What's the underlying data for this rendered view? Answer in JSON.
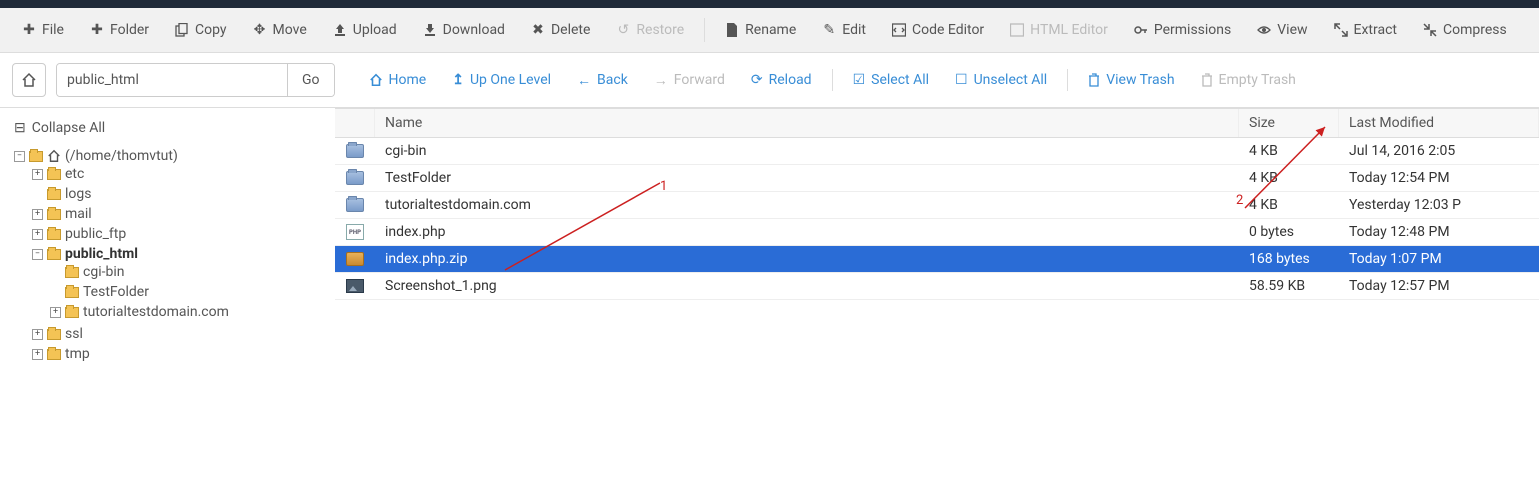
{
  "toolbar": {
    "file": "File",
    "folder": "Folder",
    "copy": "Copy",
    "move": "Move",
    "upload": "Upload",
    "download": "Download",
    "delete": "Delete",
    "restore": "Restore",
    "rename": "Rename",
    "edit": "Edit",
    "code_editor": "Code Editor",
    "html_editor": "HTML Editor",
    "permissions": "Permissions",
    "view": "View",
    "extract": "Extract",
    "compress": "Compress"
  },
  "path": {
    "value": "public_html",
    "go": "Go"
  },
  "nav": {
    "home": "Home",
    "up": "Up One Level",
    "back": "Back",
    "forward": "Forward",
    "reload": "Reload",
    "select_all": "Select All",
    "unselect_all": "Unselect All",
    "view_trash": "View Trash",
    "empty_trash": "Empty Trash"
  },
  "sidebar": {
    "collapse": "Collapse All",
    "root": "(/home/thomvtut)",
    "nodes": {
      "etc": "etc",
      "logs": "logs",
      "mail": "mail",
      "public_ftp": "public_ftp",
      "public_html": "public_html",
      "cgi_bin": "cgi-bin",
      "testfolder": "TestFolder",
      "tutorial": "tutorialtestdomain.com",
      "ssl": "ssl",
      "tmp": "tmp"
    }
  },
  "headers": {
    "name": "Name",
    "size": "Size",
    "modified": "Last Modified"
  },
  "files": [
    {
      "type": "folder",
      "name": "cgi-bin",
      "size": "4 KB",
      "date": "Jul 14, 2016 2:05 "
    },
    {
      "type": "folder",
      "name": "TestFolder",
      "size": "4 KB",
      "date": "Today 12:54 PM"
    },
    {
      "type": "folder",
      "name": "tutorialtestdomain.com",
      "size": "4 KB",
      "date": "Yesterday 12:03 P"
    },
    {
      "type": "php",
      "name": "index.php",
      "size": "0 bytes",
      "date": "Today 12:48 PM"
    },
    {
      "type": "zip",
      "name": "index.php.zip",
      "size": "168 bytes",
      "date": "Today 1:07 PM",
      "selected": true
    },
    {
      "type": "img",
      "name": "Screenshot_1.png",
      "size": "58.59 KB",
      "date": "Today 12:57 PM"
    }
  ],
  "annotations": {
    "one": "1",
    "two": "2"
  }
}
